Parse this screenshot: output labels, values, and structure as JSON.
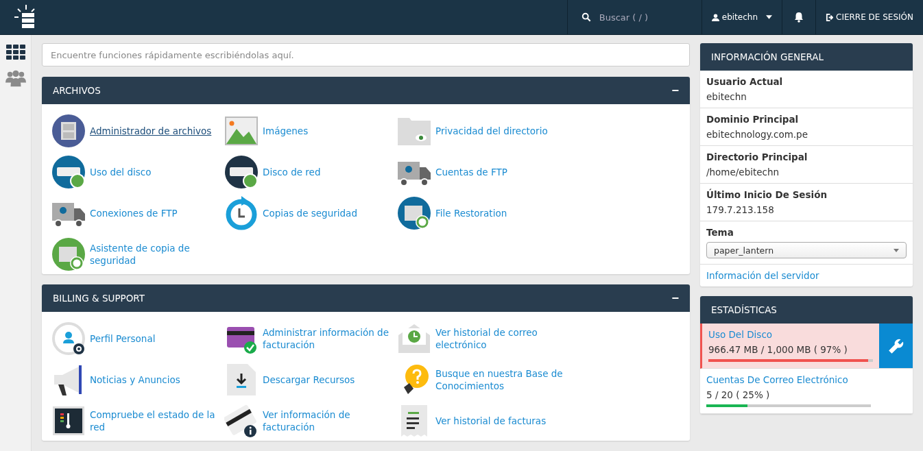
{
  "topbar": {
    "search": {
      "placeholder": "Buscar ( / )"
    },
    "user": "ebitechn",
    "logout": "CIERRE DE SESIÓN"
  },
  "quick_search": {
    "placeholder": "Encuentre funciones rápidamente escribiéndolas aquí."
  },
  "sections": [
    {
      "title": "ARCHIVOS",
      "collapse": "−",
      "items": [
        {
          "label": "Administrador de archivos",
          "hovered": true
        },
        {
          "label": "Imágenes",
          "hovered": false
        },
        {
          "label": "Privacidad del directorio",
          "hovered": false
        },
        {
          "label": "Uso del disco",
          "hovered": false
        },
        {
          "label": "Disco de red",
          "hovered": false
        },
        {
          "label": "Cuentas de FTP",
          "hovered": false
        },
        {
          "label": "Conexiones de FTP",
          "hovered": false
        },
        {
          "label": "Copias de seguridad",
          "hovered": false
        },
        {
          "label": "File Restoration",
          "hovered": false
        },
        {
          "label": "Asistente de copia de seguridad",
          "hovered": false
        }
      ]
    },
    {
      "title": "BILLING & SUPPORT",
      "collapse": "−",
      "items": [
        {
          "label": "Perfil Personal",
          "hovered": false
        },
        {
          "label": "Administrar información de facturación",
          "hovered": false
        },
        {
          "label": "Ver historial de correo electrónico",
          "hovered": false
        },
        {
          "label": "Noticias y Anuncios",
          "hovered": false
        },
        {
          "label": "Descargar Recursos",
          "hovered": false
        },
        {
          "label": "Busque en nuestra Base de Conocimientos",
          "hovered": false
        },
        {
          "label": "Compruebe el estado de la red",
          "hovered": false
        },
        {
          "label": "Ver información de facturación",
          "hovered": false
        },
        {
          "label": "Ver historial de facturas",
          "hovered": false
        }
      ]
    }
  ],
  "general_info": {
    "title": "INFORMACIÓN GENERAL",
    "rows": [
      {
        "label": "Usuario Actual",
        "value": "ebitechn"
      },
      {
        "label": "Dominio Principal",
        "value": "ebitechnology.com.pe"
      },
      {
        "label": "Directorio Principal",
        "value": "/home/ebitechn"
      },
      {
        "label": "Último Inicio De Sesión",
        "value": "179.7.213.158"
      }
    ],
    "theme": {
      "label": "Tema",
      "value": "paper_lantern"
    },
    "server_link": "Información del servidor"
  },
  "stats": {
    "title": "ESTADÍSTICAS",
    "items": [
      {
        "label": "Uso Del Disco",
        "reading": "966.47 MB / 1,000 MB ( 97% )",
        "level": 0.97,
        "alert": true
      },
      {
        "label": "Cuentas De Correo Electrónico",
        "reading": "5 / 20 ( 25% )",
        "level": 0.25,
        "alert": false
      }
    ]
  }
}
